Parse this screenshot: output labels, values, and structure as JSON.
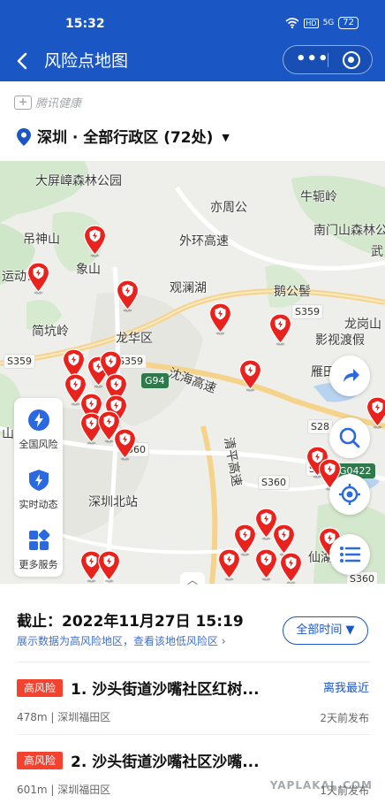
{
  "status_bar": {
    "time": "15:32",
    "network": "HD",
    "signal": "5G",
    "battery": "72"
  },
  "navbar": {
    "title": "风险点地图",
    "back_icon": "chevron-left-icon",
    "more_icon": "more-dots-icon",
    "close_icon": "target-close-icon"
  },
  "brand": {
    "name": "腾讯健康",
    "icon": "plus-box-icon"
  },
  "location": {
    "text": "深圳 · 全部行政区 (72处)",
    "caret": "▼"
  },
  "map": {
    "labels": [
      "大屏嶂森林公园",
      "亦周公",
      "牛轭岭",
      "吊神山",
      "象山",
      "外环高速",
      "南门山森林公",
      "运动公",
      "观澜湖",
      "鹅公髻",
      "简坑岭",
      "龙华区",
      "沈海高速",
      "龙岗山",
      "影视渡假",
      "雁田水库",
      "清平高速",
      "深圳北站",
      "山",
      "武",
      "仙湖"
    ],
    "road_tags": [
      "S359",
      "S359",
      "S359",
      "G94",
      "S28",
      "G0422",
      "S360",
      "S360",
      "360",
      "S360"
    ]
  },
  "left_panel": [
    {
      "label": "全国风险",
      "icon": "lightning-shield-icon"
    },
    {
      "label": "实时动态",
      "icon": "lightning-shield-icon"
    },
    {
      "label": "更多服务",
      "icon": "grid-apps-icon"
    }
  ],
  "right_buttons": [
    "share-arrow-icon",
    "search-icon",
    "locate-icon",
    "list-icon"
  ],
  "panel": {
    "deadline": "截止：2022年11月27日 15:19",
    "note": "展示数据为高风险地区，查看该地低风险区 ›",
    "time_filter": "全部时间 ▼"
  },
  "risk_list": [
    {
      "badge": "高风险",
      "name": "1. 沙头街道沙嘴社区红树...",
      "meta": "478m | 深圳福田区",
      "tag": "离我最近",
      "when": "2天前发布"
    },
    {
      "badge": "高风险",
      "name": "2. 沙头街道沙嘴社区沙嘴...",
      "meta": "601m | 深圳福田区",
      "tag": "",
      "when": "1天前发布"
    }
  ],
  "watermark": "YAPLAKAL.COM",
  "colors": {
    "nav_blue": "#1a56c4",
    "risk_red": "#f5422f",
    "pin_red": "#e8221c",
    "park_green": "#c9e4c3",
    "water_blue": "#a9c9ec"
  }
}
